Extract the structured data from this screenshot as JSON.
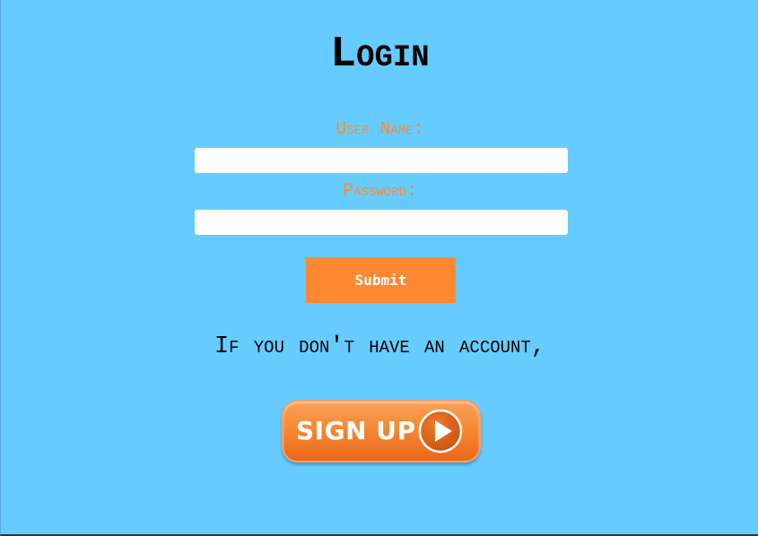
{
  "login": {
    "title": "Login",
    "username_label": "User Name:",
    "password_label": "Password:",
    "username_value": "",
    "password_value": "",
    "submit_label": "Submit"
  },
  "signup": {
    "prompt_text": "If you don't have an account,",
    "button_label": "SIGN UP",
    "button_icon": "play-icon"
  },
  "colors": {
    "background": "#66ccff",
    "accent": "#ff8833",
    "input_background": "#ffffff"
  }
}
